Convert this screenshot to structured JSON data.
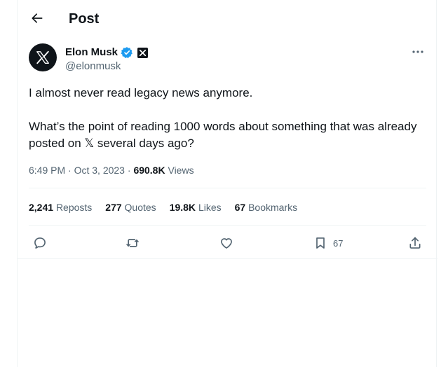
{
  "header": {
    "title": "Post"
  },
  "author": {
    "display_name": "Elon Musk",
    "handle": "@elonmusk",
    "avatar_icon": "x-logo-icon",
    "verified_color": "#1d9bf0"
  },
  "tweet": {
    "paragraph_1": "I almost never read legacy news anymore.",
    "paragraph_2": "What’s the point of reading 1000 words about something that was already\nposted on 𝕏 several days ago?",
    "time": "6:49 PM",
    "date": "Oct 3, 2023",
    "separator": "·",
    "views_count": "690.8K",
    "views_label": "Views"
  },
  "stats": [
    {
      "count": "2,241",
      "label": "Reposts"
    },
    {
      "count": "277",
      "label": "Quotes"
    },
    {
      "count": "19.8K",
      "label": "Likes"
    },
    {
      "count": "67",
      "label": "Bookmarks"
    }
  ],
  "actions": {
    "bookmark_count": "67"
  },
  "colors": {
    "text_primary": "#0f1419",
    "text_secondary": "#536471",
    "divider": "#eff3f4"
  }
}
